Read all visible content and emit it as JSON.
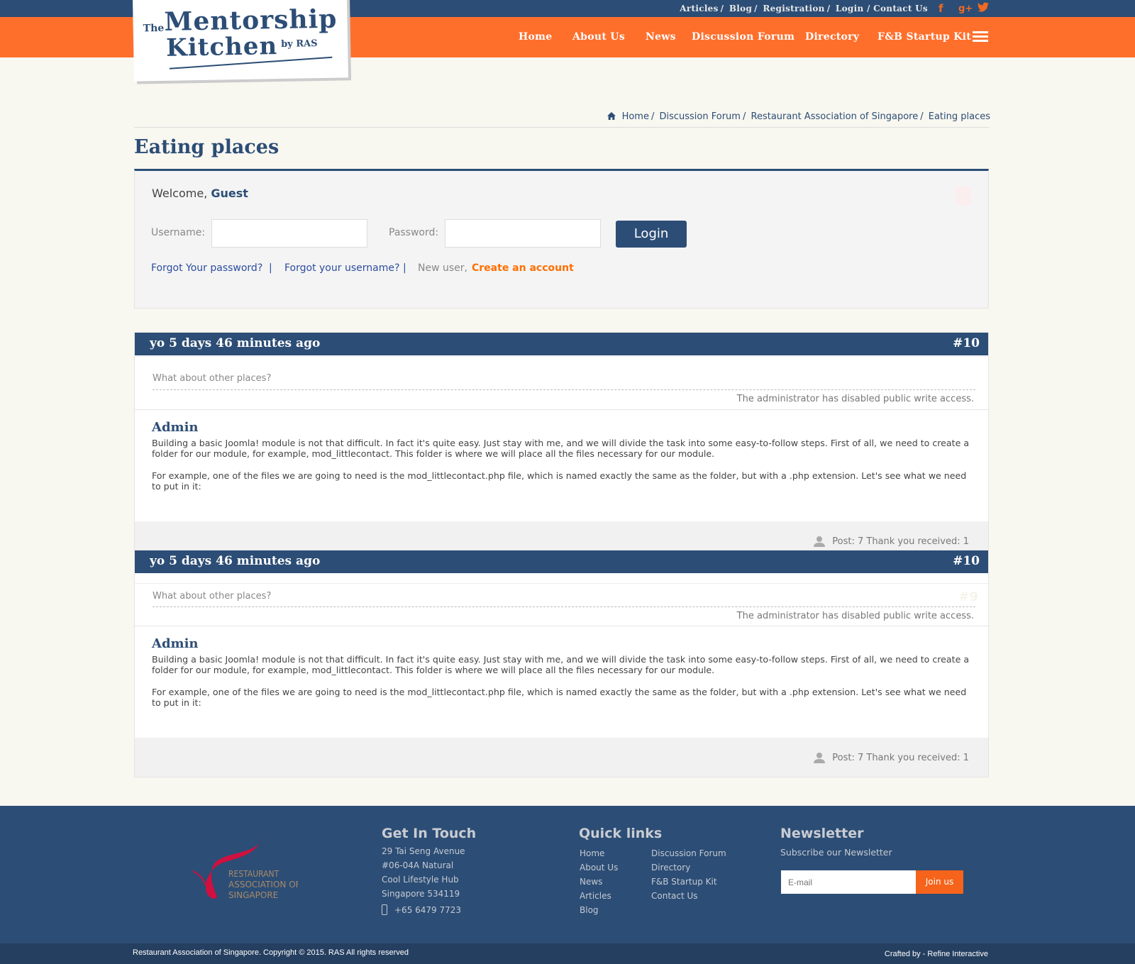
{
  "topbar": {
    "links": [
      "Articles",
      "Blog",
      "Registration",
      "Login",
      "Contact Us"
    ],
    "social": [
      "facebook-icon",
      "google-plus-icon",
      "twitter-icon"
    ]
  },
  "logo": {
    "text": "The Mentorship Kitchen by RAS"
  },
  "nav": {
    "items": [
      "Home",
      "About Us",
      "News",
      "Discussion Forum",
      "Directory",
      "F&B Startup Kit"
    ]
  },
  "breadcrumb": [
    "Home",
    "Discussion Forum",
    "Restaurant Association of Singapore",
    "Eating places"
  ],
  "page_title": "Eating places",
  "login": {
    "welcome": "Welcome,",
    "guest": "Guest",
    "username_label": "Username:",
    "password_label": "Password:",
    "username_value": "",
    "password_value": "",
    "button": "Login",
    "forgot_password": "Forgot Your password?",
    "forgot_username": "Forgot your username?",
    "new_user": "New user,",
    "create_account": "Create an account",
    "sep": "|"
  },
  "posts": [
    {
      "title": "yo 5 days 46 minutes ago",
      "number": "#10",
      "question": "What about other places?",
      "ghost": "",
      "notice": "The administrator has disabled public write access.",
      "author": "Admin",
      "paragraphs": [
        "Building a basic Joomla! module is not that difficult. In fact it's quite easy. Just stay with me, and we will divide the task into some easy-to-follow steps. First of all, we need to create a folder for our module, for example, mod_littlecontact. This folder is where we will place all the files necessary for our module.",
        "For example, one of the files we are going to need is the mod_littlecontact.php file, which is named exactly the same as the folder, but with a .php extension. Let's see what we need to put in it:"
      ],
      "stats": "Post: 7 Thank you received: 1"
    },
    {
      "title": "yo 5 days 46 minutes ago",
      "number": "#10",
      "question": "What about other places?",
      "ghost": "#9",
      "notice": "The administrator has disabled public write access.",
      "author": "Admin",
      "paragraphs": [
        "Building a basic Joomla! module is not that difficult. In fact it's quite easy. Just stay with me, and we will divide the task into some easy-to-follow steps. First of all, we need to create a folder for our module, for example, mod_littlecontact. This folder is where we will place all the files necessary for our module.",
        "For example, one of the files we are going to need is the mod_littlecontact.php file, which is named exactly the same as the folder, but with a .php extension. Let's see what we need to put in it:"
      ],
      "stats": "Post: 7 Thank you received: 1"
    }
  ],
  "footer": {
    "ras_logo": "Restaurant Association of Singapore",
    "contact_title": "Get In Touch",
    "address": [
      "29 Tai Seng Avenue",
      "#06-04A Natural",
      "Cool Lifestyle Hub",
      "Singapore 534119"
    ],
    "phone": "+65 6479 7723",
    "quick_title": "Quick links",
    "quick_col1": [
      "Home",
      "About Us",
      "News",
      "Articles",
      "Blog"
    ],
    "quick_col2": [
      "Discussion Forum",
      "Directory",
      "F&B Startup Kit",
      "Contact Us"
    ],
    "newsletter_title": "Newsletter",
    "newsletter_sub": "Subscribe our Newsletter",
    "email_placeholder": "E-mail",
    "join": "Join us",
    "copyright": "Restaurant Association of Singapore. Copyright © 2015. RAS All rights reserved",
    "crafted": "Crafted by - Refine Interactive"
  },
  "colors": {
    "navy": "#2c4d75",
    "orange": "#ff6f2c",
    "accent_orange": "#f6631a",
    "background": "#f8f7f0"
  }
}
